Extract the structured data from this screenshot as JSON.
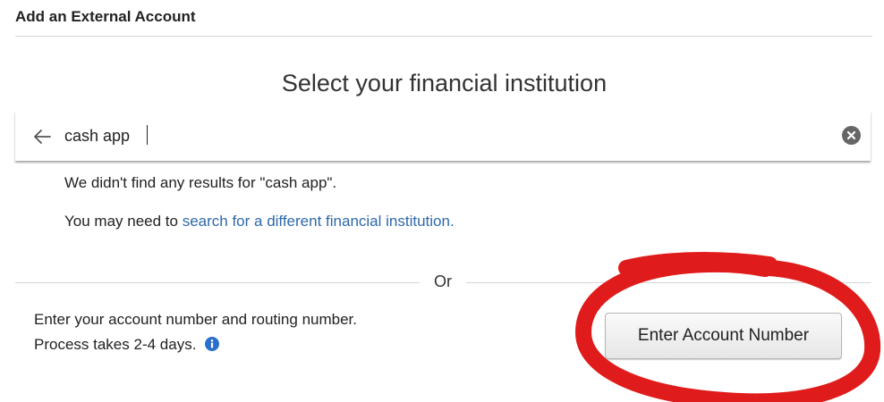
{
  "header": {
    "title": "Add an External Account"
  },
  "main": {
    "heading": "Select your financial institution",
    "search": {
      "value": "cash app",
      "back_icon": "arrow-left-icon",
      "clear_icon": "clear-circle-x-icon"
    },
    "no_results_text": "We didn't find any results for \"cash app\".",
    "hint_prefix": "You may need to ",
    "hint_link": "search for a different financial institution.",
    "divider_text": "Or",
    "manual_entry": {
      "line1": "Enter your account number and routing number.",
      "line2": "Process takes 2-4 days.",
      "info_icon": "info-circle-icon",
      "button_label": "Enter Account Number"
    }
  },
  "annotation": {
    "shape": "hand-drawn-circle",
    "color": "#e01b1b"
  },
  "colors": {
    "link": "#2f68aa",
    "info": "#2a6fc9"
  }
}
